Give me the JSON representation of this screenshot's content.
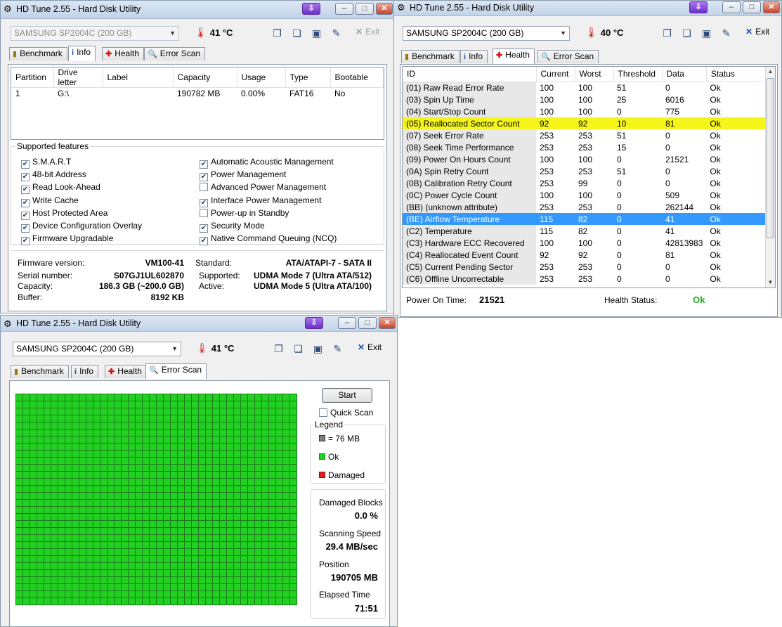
{
  "app_title": "HD Tune 2.55 - Hard Disk Utility",
  "title_controls": {
    "pin": "⇩",
    "minimize": "–",
    "maximize": "□",
    "close": "✕"
  },
  "toolbar": {
    "drive": "SAMSUNG SP2004C (200 GB)",
    "exit_label": "Exit",
    "icons": [
      "copy-text-icon",
      "copy-screenshot-icon",
      "save-icon",
      "options-icon"
    ]
  },
  "tabs": {
    "benchmark": "Benchmark",
    "info": "Info",
    "health": "Health",
    "error_scan": "Error Scan"
  },
  "info_window": {
    "temperature": "41 °C",
    "partition_headers": [
      "Partition",
      "Drive letter",
      "Label",
      "Capacity",
      "Usage",
      "Type",
      "Bootable"
    ],
    "partitions": [
      [
        "1",
        "G:\\",
        "",
        "190782 MB",
        "0.00%",
        "FAT16",
        "No"
      ]
    ],
    "features_title": "Supported features",
    "features_left": [
      "S.M.A.R.T",
      "48-bit Address",
      "Read Look-Ahead",
      "Write Cache",
      "Host Protected Area",
      "Device Configuration Overlay",
      "Firmware Upgradable"
    ],
    "features_left_checked": [
      true,
      true,
      true,
      true,
      true,
      true,
      true
    ],
    "features_right": [
      "Automatic Acoustic Management",
      "Power Management",
      "Advanced Power Management",
      "Interface Power Management",
      "Power-up in Standby",
      "Security Mode",
      "Native Command Queuing (NCQ)"
    ],
    "features_right_checked": [
      true,
      true,
      false,
      true,
      false,
      true,
      true
    ],
    "firmware_label": "Firmware version:",
    "firmware": "VM100-41",
    "serial_label": "Serial number:",
    "serial": "S07GJ1UL602870",
    "capacity_label": "Capacity:",
    "capacity": "186.3 GB (~200.0 GB)",
    "buffer_label": "Buffer:",
    "buffer": "8192 KB",
    "standard_label": "Standard:",
    "standard": "ATA/ATAPI-7 - SATA II",
    "supported_label": "Supported:",
    "supported": "UDMA Mode 7 (Ultra ATA/512)",
    "active_label": "Active:",
    "active": "UDMA Mode 5 (Ultra ATA/100)"
  },
  "health_window": {
    "temperature": "40 °C",
    "headers": [
      "ID",
      "Current",
      "Worst",
      "Threshold",
      "Data",
      "Status"
    ],
    "rows": [
      [
        "(01) Raw Read Error Rate",
        "100",
        "100",
        "51",
        "0",
        "Ok"
      ],
      [
        "(03) Spin Up Time",
        "100",
        "100",
        "25",
        "6016",
        "Ok"
      ],
      [
        "(04) Start/Stop Count",
        "100",
        "100",
        "0",
        "775",
        "Ok"
      ],
      [
        "(05) Reallocated Sector Count",
        "92",
        "92",
        "10",
        "81",
        "Ok"
      ],
      [
        "(07) Seek Error Rate",
        "253",
        "253",
        "51",
        "0",
        "Ok"
      ],
      [
        "(08) Seek Time Performance",
        "253",
        "253",
        "15",
        "0",
        "Ok"
      ],
      [
        "(09) Power On Hours Count",
        "100",
        "100",
        "0",
        "21521",
        "Ok"
      ],
      [
        "(0A) Spin Retry Count",
        "253",
        "253",
        "51",
        "0",
        "Ok"
      ],
      [
        "(0B) Calibration Retry Count",
        "253",
        "99",
        "0",
        "0",
        "Ok"
      ],
      [
        "(0C) Power Cycle Count",
        "100",
        "100",
        "0",
        "509",
        "Ok"
      ],
      [
        "(BB) (unknown attribute)",
        "253",
        "253",
        "0",
        "262144",
        "Ok"
      ],
      [
        "(BE) Airflow Temperature",
        "115",
        "82",
        "0",
        "41",
        "Ok"
      ],
      [
        "(C2) Temperature",
        "115",
        "82",
        "0",
        "41",
        "Ok"
      ],
      [
        "(C3) Hardware ECC Recovered",
        "100",
        "100",
        "0",
        "42813983",
        "Ok"
      ],
      [
        "(C4) Reallocated Event Count",
        "92",
        "92",
        "0",
        "81",
        "Ok"
      ],
      [
        "(C5) Current Pending Sector",
        "253",
        "253",
        "0",
        "0",
        "Ok"
      ],
      [
        "(C6) Offline Uncorrectable",
        "253",
        "253",
        "0",
        "0",
        "Ok"
      ]
    ],
    "highlight_yellow_row": 3,
    "highlight_selected_row": 11,
    "power_on_label": "Power On Time:",
    "power_on": "21521",
    "health_status_label": "Health Status:",
    "health_status": "Ok",
    "status_color": "#22aa22"
  },
  "scan_window": {
    "temperature": "41 °C",
    "start_label": "Start",
    "quick_scan_label": "Quick Scan",
    "quick_scan_checked": false,
    "legend_title": "Legend",
    "legend_block": "= 76 MB",
    "legend_ok": "Ok",
    "legend_damaged": "Damaged",
    "damaged_blocks_label": "Damaged Blocks",
    "damaged_blocks": "0.0 %",
    "scanning_speed_label": "Scanning Speed",
    "scanning_speed": "29.4 MB/sec",
    "position_label": "Position",
    "position": "190705 MB",
    "elapsed_label": "Elapsed Time",
    "elapsed": "71:51",
    "block_ok_color": "#22d022",
    "block_damaged_color": "#e02020"
  }
}
